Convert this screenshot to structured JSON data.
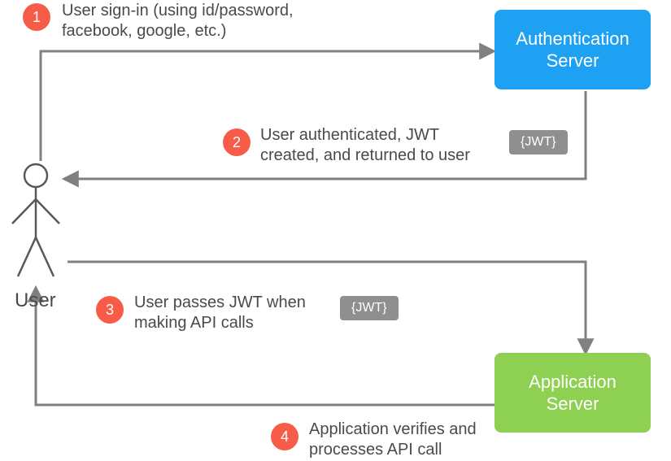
{
  "actors": {
    "user_label": "User",
    "auth_server_label": "Authentication\nServer",
    "app_server_label": "Application\nServer"
  },
  "steps": {
    "s1": {
      "num": "1",
      "text": "User sign-in (using id/password,\nfacebook, google, etc.)"
    },
    "s2": {
      "num": "2",
      "text": "User authenticated, JWT\ncreated, and returned to user"
    },
    "s3": {
      "num": "3",
      "text": "User passes JWT when\nmaking API calls"
    },
    "s4": {
      "num": "4",
      "text": "Application verifies and\nprocesses API call"
    }
  },
  "tokens": {
    "jwt1": "{JWT}",
    "jwt2": "{JWT}"
  },
  "colors": {
    "badge": "#f75c48",
    "auth_box": "#1ea1f2",
    "app_box": "#8ed051",
    "arrow": "#808080",
    "stick": "#585858"
  }
}
